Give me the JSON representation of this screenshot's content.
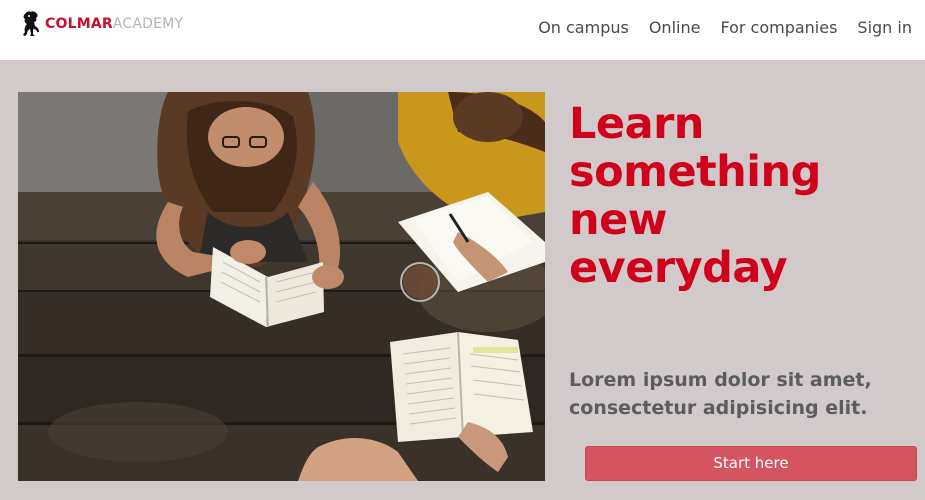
{
  "brand": {
    "name_strong": "COLMAR",
    "name_light": "ACADEMY",
    "logo_icon": "lion-crest-icon",
    "primary_color": "#c8102e",
    "secondary_color": "#b4b4b4"
  },
  "nav": {
    "items": [
      {
        "label": "On campus"
      },
      {
        "label": "Online"
      },
      {
        "label": "For companies"
      },
      {
        "label": "Sign in"
      }
    ]
  },
  "hero": {
    "photo_icon": "students-studying-photo",
    "headline_lines": [
      "Learn",
      "something",
      "new",
      "everyday"
    ],
    "headline_color": "#d0021b",
    "subtext_lines": [
      "Lorem ipsum dolor sit amet,",
      "consectetur adipisicing elit."
    ],
    "cta_label": "Start here",
    "cta_color": "#d4545f",
    "background_color": "#d2c9ca"
  }
}
